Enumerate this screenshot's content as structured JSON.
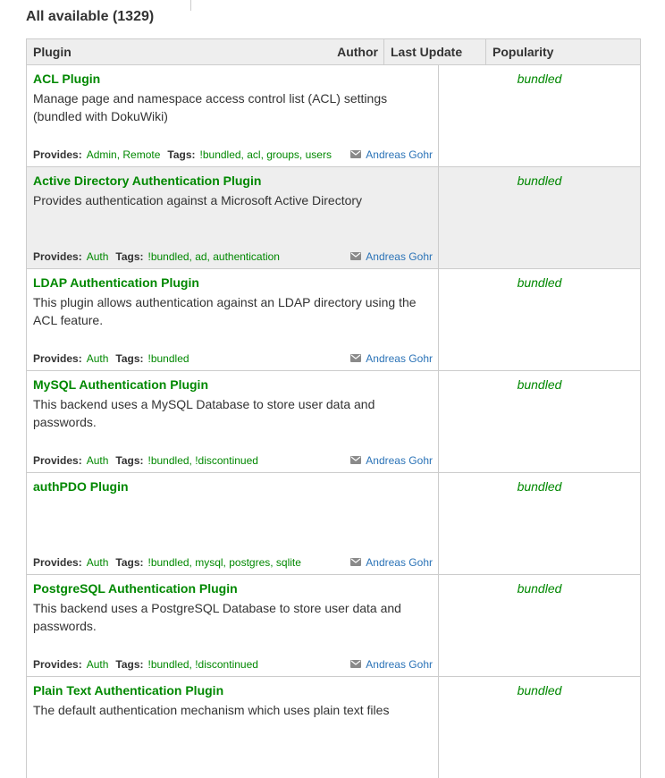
{
  "heading": "All available (1329)",
  "columns": {
    "plugin": "Plugin",
    "author": "Author",
    "last_update": "Last Update",
    "popularity": "Popularity"
  },
  "labels": {
    "provides": "Provides:",
    "tags": "Tags:"
  },
  "rows": [
    {
      "name": "ACL Plugin",
      "desc": "Manage page and namespace access control list (ACL) settings (bundled with DokuWiki)",
      "provides": "Admin, Remote",
      "tags": "!bundled, acl, groups, users",
      "author": "Andreas Gohr",
      "update": "bundled"
    },
    {
      "name": "Active Directory Authentication Plugin",
      "desc": "Provides authentication against a Microsoft Active Directory",
      "provides": "Auth",
      "tags": "!bundled, ad, authentication",
      "author": "Andreas Gohr",
      "update": "bundled"
    },
    {
      "name": "LDAP Authentication Plugin",
      "desc": "This plugin allows authentication against an LDAP directory using the ACL feature.",
      "provides": "Auth",
      "tags": "!bundled",
      "author": "Andreas Gohr",
      "update": "bundled"
    },
    {
      "name": "MySQL Authentication Plugin",
      "desc": "This backend uses a MySQL Database to store user data and passwords.",
      "provides": "Auth",
      "tags": "!bundled, !discontinued",
      "author": "Andreas Gohr",
      "update": "bundled"
    },
    {
      "name": "authPDO Plugin",
      "desc": "",
      "provides": "Auth",
      "tags": "!bundled, mysql, postgres, sqlite",
      "author": "Andreas Gohr",
      "update": "bundled"
    },
    {
      "name": "PostgreSQL Authentication Plugin",
      "desc": "This backend uses a PostgreSQL Database to store user data and passwords.",
      "provides": "Auth",
      "tags": "!bundled, !discontinued",
      "author": "Andreas Gohr",
      "update": "bundled"
    },
    {
      "name": "Plain Text Authentication Plugin",
      "desc": "The default authentication mechanism which uses plain text files",
      "provides": "",
      "tags": "",
      "author": "",
      "update": "bundled"
    }
  ],
  "icons": {
    "author_link": "envelope-icon"
  },
  "colors": {
    "plugin_link": "#008800",
    "author_link": "#2b73b7",
    "header_bg": "#eeeeee",
    "border": "#cccccc"
  }
}
